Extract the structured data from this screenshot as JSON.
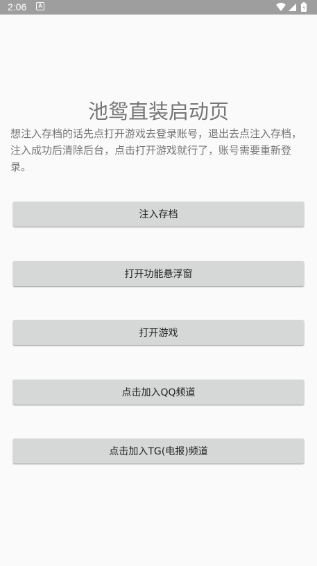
{
  "status_bar": {
    "time": "2:06",
    "notification_icon": "A",
    "icons": [
      "wifi-icon",
      "cellular-signal-icon",
      "battery-icon"
    ],
    "background_color": "#9e9e9e"
  },
  "main": {
    "title": "池鸳直装启动页",
    "instructions": "想注入存档的话先点打开游戏去登录账号，退出去点注入存档，注入成功后清除后台，点击打开游戏就行了，账号需要重新登录。",
    "buttons": [
      {
        "label": "注入存档"
      },
      {
        "label": "打开功能悬浮窗"
      },
      {
        "label": "打开游戏"
      },
      {
        "label": "点击加入QQ频道"
      },
      {
        "label": "点击加入TG(电报)频道"
      }
    ]
  },
  "colors": {
    "background": "#fafafa",
    "button": "#d6d7d7",
    "text_secondary": "#757575",
    "button_text": "#212121"
  }
}
